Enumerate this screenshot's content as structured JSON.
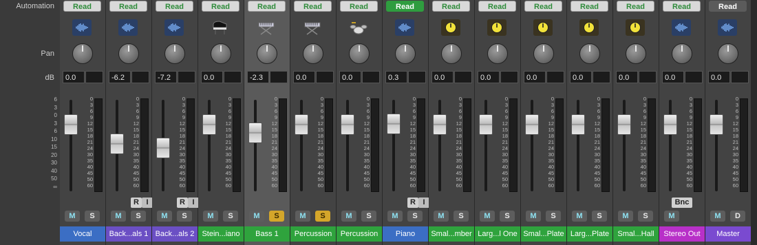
{
  "labels": {
    "automation": "Automation",
    "pan": "Pan",
    "db": "dB"
  },
  "left_scale": [
    "6",
    "3",
    "0",
    "3",
    "6",
    "10",
    "15",
    "20",
    "30",
    "40",
    "50",
    "∞"
  ],
  "meter_scale": [
    "0",
    "3",
    "6",
    "9",
    "12",
    "15",
    "18",
    "21",
    "24",
    "30",
    "35",
    "40",
    "45",
    "50",
    "60"
  ],
  "colors": {
    "blue": "#3b6ec4",
    "purple": "#6b4fc4",
    "green": "#2fa33d",
    "magenta": "#b830c8",
    "violet": "#7a4ad0"
  },
  "strips": [
    {
      "automation": "Read",
      "icon": "waveform-icon",
      "icon_type": "wave",
      "db": "0.0",
      "fader": 0.73,
      "r_label": "",
      "i_label": "",
      "m": "M",
      "s": "S",
      "s_on": false,
      "name": "Vocal",
      "color": "#3b6ec4"
    },
    {
      "automation": "Read",
      "icon": "waveform-icon",
      "icon_type": "wave",
      "db": "-6.2",
      "fader": 0.52,
      "r_label": "R",
      "i_label": "I",
      "m": "M",
      "s": "S",
      "s_on": false,
      "name": "Back...als 1",
      "color": "#6b4fc4"
    },
    {
      "automation": "Read",
      "icon": "waveform-icon",
      "icon_type": "wave",
      "db": "-7.2",
      "fader": 0.47,
      "r_label": "R",
      "i_label": "I",
      "m": "M",
      "s": "S",
      "s_on": false,
      "name": "Back...als 2",
      "color": "#6b4fc4"
    },
    {
      "automation": "Read",
      "icon": "grand-piano-icon",
      "icon_type": "inst",
      "db": "0.0",
      "fader": 0.73,
      "r_label": "",
      "i_label": "",
      "m": "M",
      "s": "S",
      "s_on": false,
      "name": "Stein...iano",
      "color": "#2fa33d"
    },
    {
      "automation": "Read",
      "icon": "keyboard-stand-icon",
      "icon_type": "inst",
      "db": "-2.3",
      "fader": 0.64,
      "r_label": "",
      "i_label": "",
      "m": "M",
      "s": "S",
      "s_on": true,
      "name": "Bass 1",
      "color": "#2fa33d",
      "selected": true
    },
    {
      "automation": "Read",
      "icon": "keyboard-stand-icon",
      "icon_type": "inst",
      "db": "0.0",
      "fader": 0.73,
      "r_label": "",
      "i_label": "",
      "m": "M",
      "s": "S",
      "s_on": true,
      "name": "Percussion",
      "color": "#2fa33d"
    },
    {
      "automation": "Read",
      "icon": "drum-kit-icon",
      "icon_type": "inst",
      "db": "0.0",
      "fader": 0.73,
      "r_label": "",
      "i_label": "",
      "m": "M",
      "s": "S",
      "s_on": false,
      "name": "Percussion",
      "color": "#2fa33d"
    },
    {
      "automation": "Read",
      "icon": "waveform-icon",
      "icon_type": "wave",
      "db": "0.3",
      "fader": 0.74,
      "r_label": "R",
      "i_label": "I",
      "m": "M",
      "s": "S",
      "s_on": false,
      "name": "Piano",
      "color": "#3b6ec4",
      "auto_active": true
    },
    {
      "automation": "Read",
      "icon": "aux-knob-icon",
      "icon_type": "mod",
      "db": "0.0",
      "fader": 0.73,
      "r_label": "",
      "i_label": "",
      "m": "M",
      "s": "S",
      "s_on": false,
      "name": "Smal...mber",
      "color": "#2fa33d"
    },
    {
      "automation": "Read",
      "icon": "aux-knob-icon",
      "icon_type": "mod",
      "db": "0.0",
      "fader": 0.73,
      "r_label": "",
      "i_label": "",
      "m": "M",
      "s": "S",
      "s_on": false,
      "name": "Larg...l One",
      "color": "#2fa33d"
    },
    {
      "automation": "Read",
      "icon": "aux-knob-icon",
      "icon_type": "mod",
      "db": "0.0",
      "fader": 0.73,
      "r_label": "",
      "i_label": "",
      "m": "M",
      "s": "S",
      "s_on": false,
      "name": "Smal...Plate",
      "color": "#2fa33d"
    },
    {
      "automation": "Read",
      "icon": "aux-knob-icon",
      "icon_type": "mod",
      "db": "0.0",
      "fader": 0.73,
      "r_label": "",
      "i_label": "",
      "m": "M",
      "s": "S",
      "s_on": false,
      "name": "Larg...Plate",
      "color": "#2fa33d"
    },
    {
      "automation": "Read",
      "icon": "aux-knob-icon",
      "icon_type": "mod",
      "db": "0.0",
      "fader": 0.73,
      "r_label": "",
      "i_label": "",
      "m": "M",
      "s": "S",
      "s_on": false,
      "name": "Smal...Hall",
      "color": "#2fa33d"
    },
    {
      "automation": "Read",
      "icon": "waveform-icon",
      "icon_type": "wave",
      "db": "0.0",
      "fader": 0.73,
      "r_label": "",
      "i_label": "",
      "m": "M",
      "s": "",
      "s_on": false,
      "bnc": "Bnc",
      "name": "Stereo Out",
      "color": "#b830c8"
    },
    {
      "automation": "Read",
      "icon": "waveform-icon",
      "icon_type": "wave",
      "db": "0.0",
      "fader": 0.73,
      "r_label": "",
      "i_label": "",
      "m": "M",
      "s": "D",
      "s_on": false,
      "name": "Master",
      "color": "#7a4ad0",
      "auto_plain": true
    }
  ]
}
